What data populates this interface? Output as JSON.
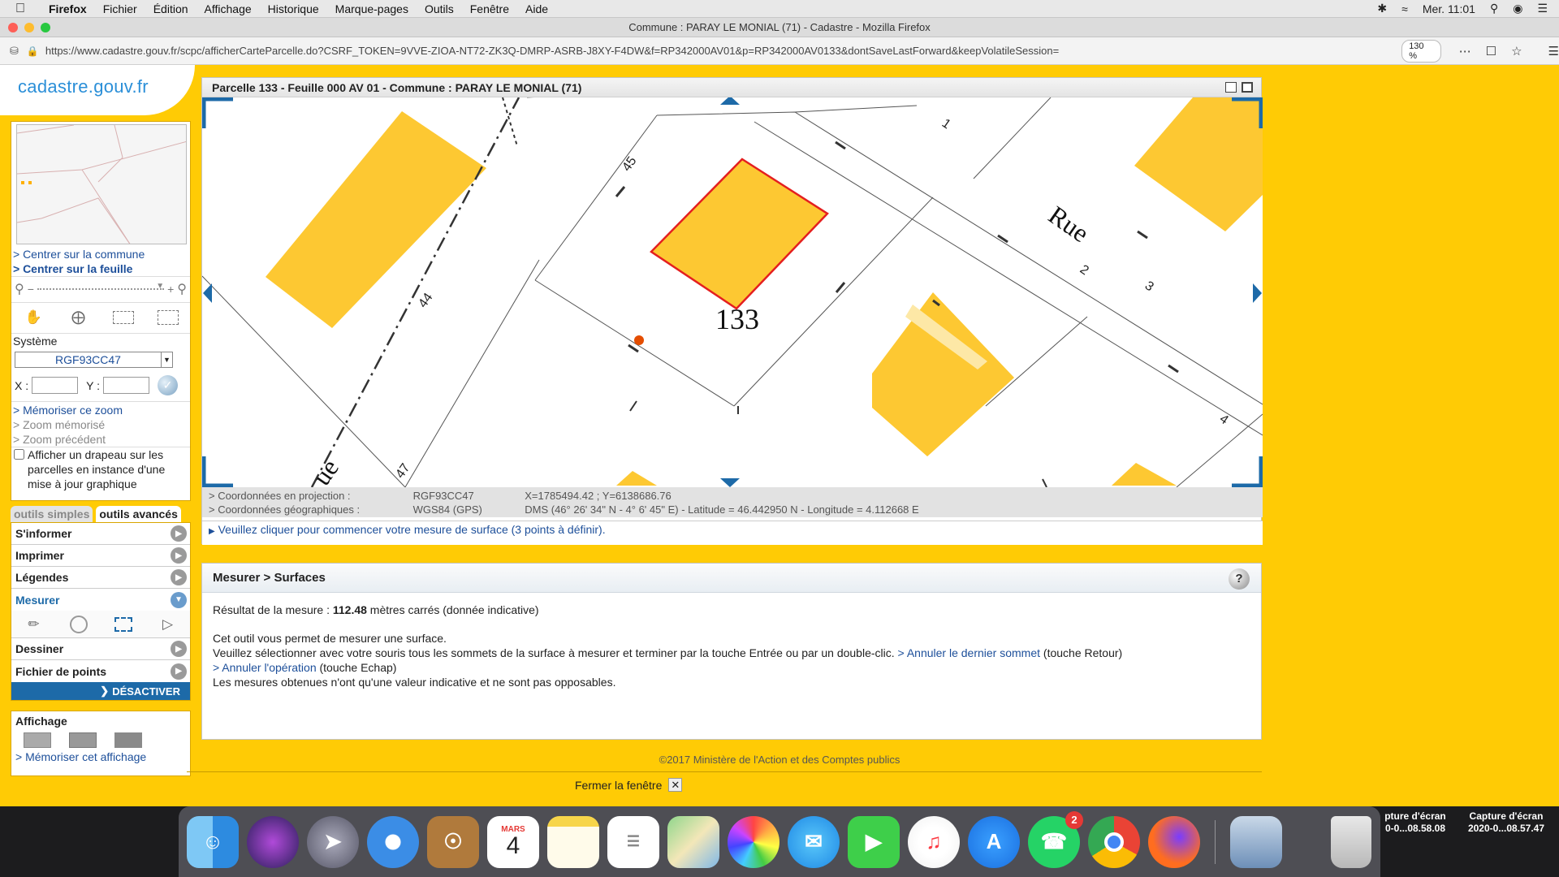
{
  "menubar": {
    "app": "Firefox",
    "items": [
      "Fichier",
      "Édition",
      "Affichage",
      "Historique",
      "Marque-pages",
      "Outils",
      "Fenêtre",
      "Aide"
    ],
    "clock": "Mer. 11:01"
  },
  "browser": {
    "window_title": "Commune : PARAY LE MONIAL (71) - Cadastre - Mozilla Firefox",
    "url": "https://www.cadastre.gouv.fr/scpc/afficherCarteParcelle.do?CSRF_TOKEN=9VVE-ZIOA-NT72-ZK3Q-DMRP-ASRB-J8XY-F4DW&f=RP342000AV01&p=RP342000AV0133&dontSaveLastForward&keepVolatileSession=",
    "zoom": "130 %"
  },
  "logo": "cadastre.gouv.fr",
  "sidebar": {
    "center_commune": "> Centrer sur la commune",
    "center_feuille": "> Centrer sur la feuille",
    "systeme_label": "Système",
    "systeme_value": "RGF93CC47",
    "x_label": "X :",
    "y_label": "Y :",
    "memoriser_zoom": "> Mémoriser ce zoom",
    "zoom_memorise": "> Zoom mémorisé",
    "zoom_precedent": "> Zoom précédent",
    "flag_label": "Afficher un drapeau sur les parcelles en instance d'une mise à jour graphique",
    "tab_simple": "outils simples",
    "tab_advanced": "outils avancés",
    "tools": [
      "S'informer",
      "Imprimer",
      "Légendes",
      "Mesurer",
      "Dessiner",
      "Fichier de points"
    ],
    "deactivate": "DÉSACTIVER",
    "affichage_title": "Affichage",
    "memoriser_affichage": "> Mémoriser cet affichage"
  },
  "map": {
    "title": "Parcelle 133 - Feuille 000 AV 01 - Commune : PARAY LE MONIAL (71)",
    "parcel_number": "133",
    "street_word": "Rue",
    "street_word_2": "ue",
    "numbers": [
      "45",
      "44",
      "47",
      "1",
      "2",
      "3",
      "4"
    ],
    "coords": {
      "proj_label": "> Coordonnées en projection :",
      "proj_system": "RGF93CC47",
      "proj_value": "X=1785494.42 ; Y=6138686.76",
      "geo_label": "> Coordonnées géographiques :",
      "geo_system": "WGS84 (GPS)",
      "geo_value": "DMS (46° 26' 34\" N - 4° 6' 45\" E) - Latitude = 46.442950 N - Longitude = 4.112668 E"
    },
    "instruction": "Veuillez cliquer pour commencer votre mesure de surface (3 points à définir)."
  },
  "measure": {
    "title": "Mesurer > Surfaces",
    "result_prefix": "Résultat de la mesure : ",
    "result_value": "112.48",
    "result_suffix": " mètres carrés (donnée indicative)",
    "line1": "Cet outil vous permet de mesurer une surface.",
    "line2": "Veuillez sélectionner avec votre souris tous les sommets de la surface à mesurer et terminer par la touche Entrée ou par un double-clic.",
    "undo_vertex_link": "> Annuler le dernier sommet",
    "undo_vertex_key": " (touche Retour)",
    "cancel_link": "> Annuler l'opération",
    "cancel_key": " (touche Echap)",
    "line4": "Les mesures obtenues n'ont qu'une valeur indicative et ne sont pas opposables."
  },
  "footer": {
    "copyright": "©2017 Ministère de l'Action et des Comptes publics",
    "close": "Fermer la fenêtre"
  },
  "dock": {
    "calendar_month": "MARS",
    "calendar_day": "4",
    "whatsapp_badge": "2",
    "desktop_files": [
      {
        "line1": "pture d'écran",
        "line2": "0-0...08.58.08"
      },
      {
        "line1": "Capture d'écran",
        "line2": "2020-0...08.57.47"
      }
    ]
  },
  "colors": {
    "page_bg": "#ffcb05",
    "building": "#fdc832",
    "parcel_outline": "#e41f1f",
    "link": "#1d4f9a"
  }
}
